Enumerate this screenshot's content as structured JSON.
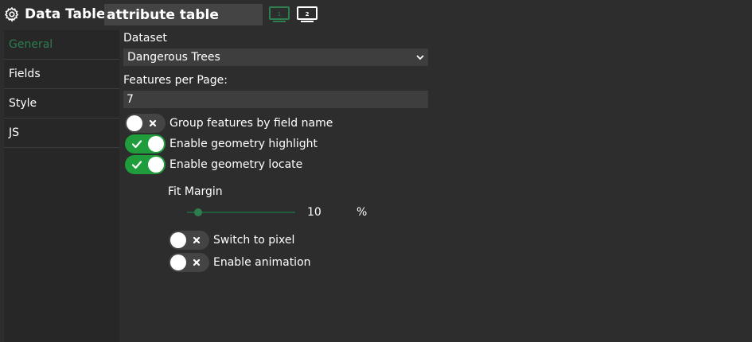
{
  "header": {
    "title": "Data Table",
    "name_value": "attribute table",
    "screen_buttons": [
      {
        "label": "1",
        "icon": "monitor-icon",
        "color": "#2e7d4f",
        "active": true
      },
      {
        "label": "2",
        "icon": "monitor-icon",
        "color": "#ffffff",
        "active": false
      }
    ]
  },
  "sidebar": {
    "items": [
      {
        "label": "General",
        "active": true
      },
      {
        "label": "Fields",
        "active": false
      },
      {
        "label": "Style",
        "active": false
      },
      {
        "label": "JS",
        "active": false
      }
    ]
  },
  "general": {
    "dataset_label": "Dataset",
    "dataset_value": "Dangerous Trees",
    "features_label": "Features per Page:",
    "features_value": "7",
    "toggles": [
      {
        "label": "Group features by field name",
        "on": false
      },
      {
        "label": "Enable geometry highlight",
        "on": true
      },
      {
        "label": "Enable geometry locate",
        "on": true
      }
    ],
    "fit_margin": {
      "label": "Fit Margin",
      "value": "10",
      "unit": "%",
      "fraction": 0.1
    },
    "sub_toggles": [
      {
        "label": "Switch to pixel",
        "on": false
      },
      {
        "label": "Enable animation",
        "on": false
      }
    ]
  },
  "colors": {
    "accent": "#2e7d4f",
    "toggle_on": "#1f9d3c",
    "background": "#2d2d2d",
    "sidebar": "#272727"
  }
}
